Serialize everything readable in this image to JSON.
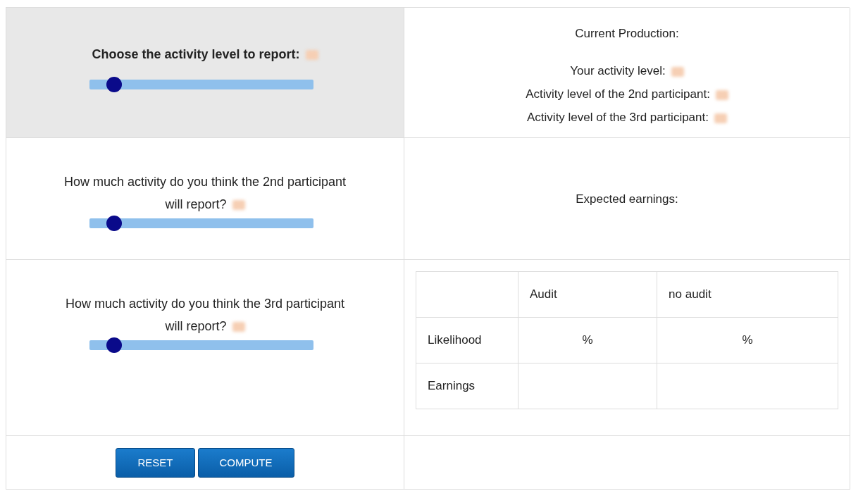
{
  "report": {
    "label": "Choose the activity level to report:",
    "level": 0.11
  },
  "guesses": [
    {
      "label": "How much activity do you think the 2nd participant will report?",
      "level": 0.11
    },
    {
      "label": "How much activity do you think the 3rd participant will report?",
      "level": 0.11
    }
  ],
  "production": {
    "title": "Current Production:",
    "lines": [
      "Your activity level:",
      "Activity level of the 2nd participant:",
      "Activity level of the 3rd participant:"
    ]
  },
  "expected_earnings": {
    "label": "Expected earnings:"
  },
  "table": {
    "columns": [
      "Audit",
      "no audit"
    ],
    "rows": [
      {
        "label": "Likelihood",
        "cells": [
          "%",
          "%"
        ]
      },
      {
        "label": "Earnings",
        "cells": []
      }
    ]
  },
  "buttons": [
    "RESET",
    "COMPUTE"
  ]
}
